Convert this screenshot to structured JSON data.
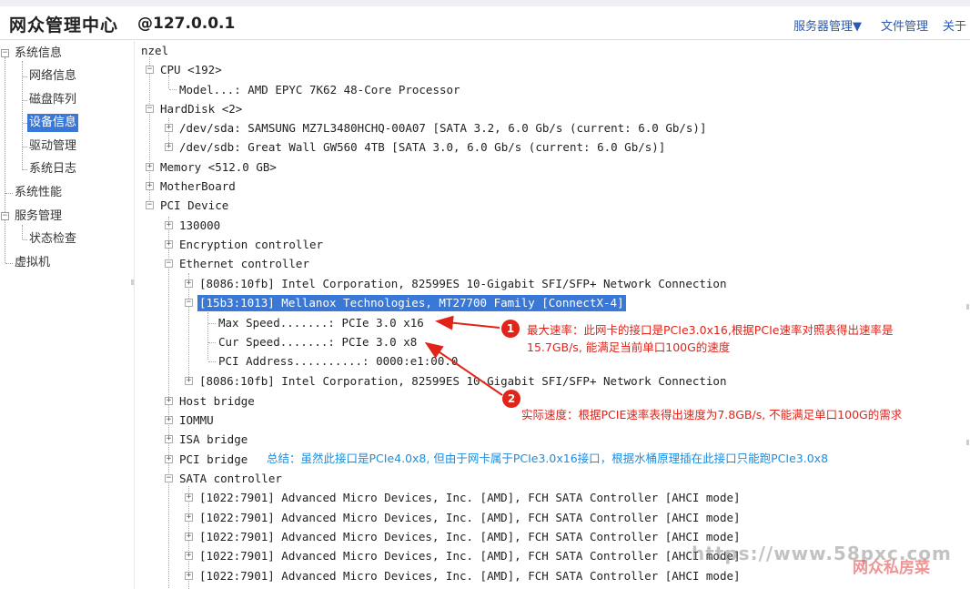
{
  "header": {
    "brand": "网众管理中心",
    "host": "@127.0.0.1",
    "nav": {
      "server_mgmt": "服务器管理▼",
      "file_mgmt": "文件管理",
      "about": "关于"
    }
  },
  "sidebar": {
    "system_info": "系统信息",
    "network_info": "网络信息",
    "disk_array": "磁盘阵列",
    "device_info": "设备信息",
    "driver_mgmt": "驱动管理",
    "system_log": "系统日志",
    "system_perf": "系统性能",
    "service_mgmt": "服务管理",
    "status_check": "状态检查",
    "virtual_machine": "虚拟机"
  },
  "tree": {
    "root": "nzel",
    "cpu": "CPU <192>",
    "cpu_model": "Model...: AMD EPYC 7K62 48-Core Processor",
    "harddisk": "HardDisk <2>",
    "sda": "/dev/sda: SAMSUNG MZ7L3480HCHQ-00A07 [SATA 3.2, 6.0 Gb/s (current: 6.0 Gb/s)]",
    "sdb": "/dev/sdb: Great Wall GW560 4TB [SATA 3.0, 6.0 Gb/s (current: 6.0 Gb/s)]",
    "memory": "Memory <512.0 GB>",
    "motherboard": "MotherBoard",
    "pci_device": "PCI Device",
    "pci_130000": "130000",
    "encryption": "Encryption controller",
    "ethernet": "Ethernet controller",
    "eth1": "[8086:10fb] Intel Corporation, 82599ES 10-Gigabit SFI/SFP+ Network Connection",
    "eth2": "[15b3:1013] Mellanox Technologies, MT27700 Family [ConnectX-4]",
    "max_speed": "Max Speed.......: PCIe 3.0 x16",
    "cur_speed": "Cur Speed.......: PCIe 3.0 x8",
    "pci_address": "PCI Address..........: 0000:e1:00.0",
    "eth3": "[8086:10fb] Intel Corporation, 82599ES 10-Gigabit SFI/SFP+ Network Connection",
    "host_bridge": "Host bridge",
    "iommu": "IOMMU",
    "isa_bridge": "ISA bridge",
    "pci_bridge": "PCI bridge",
    "sata_controller": "SATA controller",
    "sata_items": [
      "[1022:7901] Advanced Micro Devices, Inc. [AMD], FCH SATA Controller [AHCI mode]",
      "[1022:7901] Advanced Micro Devices, Inc. [AMD], FCH SATA Controller [AHCI mode]",
      "[1022:7901] Advanced Micro Devices, Inc. [AMD], FCH SATA Controller [AHCI mode]",
      "[1022:7901] Advanced Micro Devices, Inc. [AMD], FCH SATA Controller [AHCI mode]",
      "[1022:7901] Advanced Micro Devices, Inc. [AMD], FCH SATA Controller [AHCI mode]"
    ]
  },
  "annotations": {
    "badge1": "1",
    "badge2": "2",
    "note1_line1": "最大速率：此网卡的接口是PCIe3.0x16,根据PCIe速率对照表得出速率是",
    "note1_line2": "15.7GB/s, 能满足当前单口100G的速度",
    "note2": "实际速度：根据PCIE速率表得出速度为7.8GB/s, 不能满足单口100G的需求",
    "summary": "总结：虽然此接口是PCIe4.0x8, 但由于网卡属于PCIe3.0x16接口，根据水桶原理插在此接口只能跑PCIe3.0x8",
    "red_color": "#e2231a",
    "blue_color": "#1a8ee0"
  },
  "watermark": {
    "url": "https://www.58pxc.com",
    "name": "网众私房菜"
  }
}
